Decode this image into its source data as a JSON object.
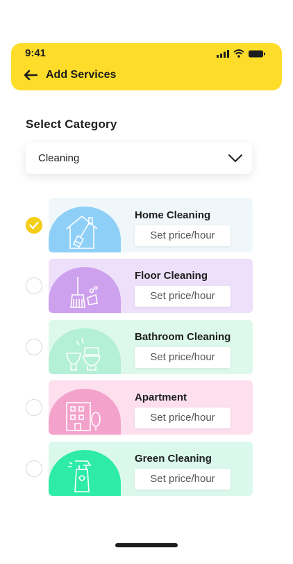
{
  "status_bar": {
    "time": "9:41"
  },
  "header": {
    "title": "Add Services"
  },
  "category": {
    "label": "Select Category",
    "selected": "Cleaning"
  },
  "services": [
    {
      "name": "Home Cleaning",
      "price_label": "Set price/hour",
      "checked": true,
      "bg": "#EFF7FA",
      "blob": "#8ECFF7",
      "icon": "house-broom-icon"
    },
    {
      "name": "Floor Cleaning",
      "price_label": "Set price/hour",
      "checked": false,
      "bg": "#EEE0FB",
      "blob": "#CDA1EE",
      "icon": "broom-dustpan-icon"
    },
    {
      "name": "Bathroom Cleaning",
      "price_label": "Set price/hour",
      "checked": false,
      "bg": "#DDF9EC",
      "blob": "#B3F0D6",
      "icon": "toilet-icon"
    },
    {
      "name": "Apartment",
      "price_label": "Set price/hour",
      "checked": false,
      "bg": "#FDDFEE",
      "blob": "#F3A3CB",
      "icon": "building-icon"
    },
    {
      "name": "Green Cleaning",
      "price_label": "Set price/hour",
      "checked": false,
      "bg": "#DAF9EC",
      "blob": "#2EEBA9",
      "icon": "spray-bottle-icon"
    }
  ],
  "colors": {
    "accent": "#FDDD2A",
    "check": "#F4CE16"
  }
}
